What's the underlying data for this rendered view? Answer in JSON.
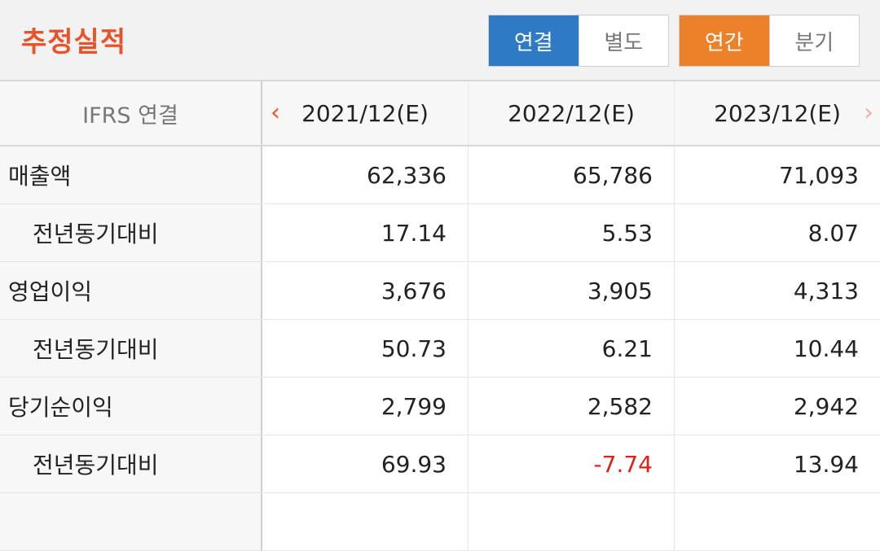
{
  "header": {
    "title": "추정실적",
    "consolidation_toggle": {
      "options": [
        "연결",
        "별도"
      ],
      "selected": "연결"
    },
    "period_toggle": {
      "options": [
        "연간",
        "분기"
      ],
      "selected": "연간"
    }
  },
  "table": {
    "corner_label": "IFRS 연결",
    "columns": [
      "2021/12(E)",
      "2022/12(E)",
      "2023/12(E)"
    ],
    "rows": [
      {
        "label": "매출액",
        "values": [
          "62,336",
          "65,786",
          "71,093"
        ]
      },
      {
        "label": "전년동기대비",
        "values": [
          "17.14",
          "5.53",
          "8.07"
        ]
      },
      {
        "label": "영업이익",
        "values": [
          "3,676",
          "3,905",
          "4,313"
        ]
      },
      {
        "label": "전년동기대비",
        "values": [
          "50.73",
          "6.21",
          "10.44"
        ]
      },
      {
        "label": "당기순이익",
        "values": [
          "2,799",
          "2,582",
          "2,942"
        ]
      },
      {
        "label": "전년동기대비",
        "values": [
          "69.93",
          "-7.74",
          "13.94"
        ]
      }
    ]
  },
  "colors": {
    "title": "#e8542a",
    "consolidated_active": "#2f7ac4",
    "annual_active": "#eb8128",
    "negative": "#e0201b"
  },
  "icons": {
    "prev": "chevron-left-icon",
    "next": "chevron-right-icon"
  }
}
